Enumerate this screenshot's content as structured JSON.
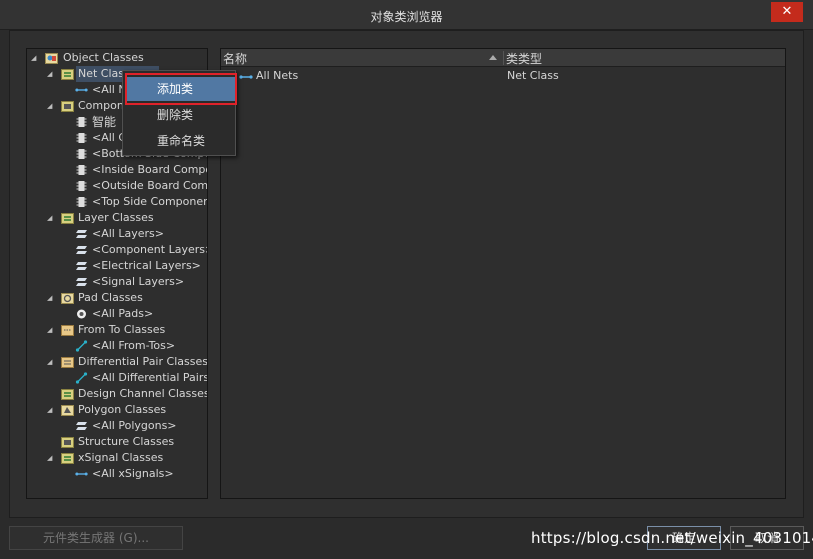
{
  "window": {
    "title": "对象类浏览器",
    "close_label": "✕"
  },
  "tree": {
    "root": "Object Classes",
    "net_classes": "Net Classes",
    "all_nets_short": "<All N",
    "component_classes": "Compon",
    "comp_item_1": "智能",
    "comp_item_2": "<All C",
    "comp_item_3": "<Bottom Side Compo",
    "comp_item_4": "<Inside Board Compo",
    "comp_item_5": "<Outside Board Comp",
    "comp_item_6": "<Top Side Component",
    "layer_classes": "Layer Classes",
    "all_layers": "<All Layers>",
    "component_layers": "<Component Layers>",
    "electrical_layers": "<Electrical Layers>",
    "signal_layers": "<Signal Layers>",
    "pad_classes": "Pad Classes",
    "all_pads": "<All Pads>",
    "from_to_classes": "From To Classes",
    "all_from_tos": "<All From-Tos>",
    "diff_pair_classes": "Differential Pair Classes",
    "all_diff_pairs": "<All Differential Pairs>",
    "design_channel_classes": "Design Channel Classes",
    "polygon_classes": "Polygon Classes",
    "all_polygons": "<All Polygons>",
    "structure_classes": "Structure Classes",
    "xsignal_classes": "xSignal Classes",
    "all_xsignals": "<All xSignals>"
  },
  "context_menu": {
    "add": "添加类",
    "delete": "删除类",
    "rename": "重命名类"
  },
  "list": {
    "col_name": "名称",
    "col_type": "类类型",
    "rows": [
      {
        "name": "All Nets",
        "type": "Net Class"
      }
    ]
  },
  "buttons": {
    "generator": "元件类生成器 (G)...",
    "ok": "确定",
    "cancel": "取消"
  },
  "watermark": "https://blog.csdn.net/weixin_40310143",
  "colors": {
    "selection": "#5178a3",
    "highlight_box": "#e0222a",
    "close": "#c42b1c"
  }
}
